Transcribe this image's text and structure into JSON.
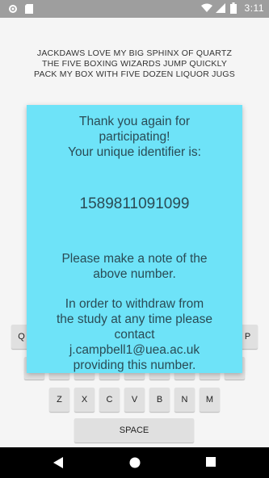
{
  "status_bar": {
    "time": "3:11",
    "left_icons": [
      "settings-icon",
      "sd-card-icon"
    ],
    "right_icons": [
      "wifi-icon",
      "signal-icon",
      "battery-icon"
    ]
  },
  "pangrams": [
    "JACKDAWS LOVE MY BIG SPHINX OF QUARTZ",
    "THE FIVE BOXING WIZARDS JUMP QUICKLY",
    "PACK MY BOX WITH FIVE DOZEN LIQUOR JUGS"
  ],
  "keyboard": {
    "visible_left_key": "Q",
    "visible_right_key": "P",
    "bottom_row": [
      "Z",
      "X",
      "C",
      "V",
      "B",
      "N",
      "M"
    ],
    "space_label": "SPACE"
  },
  "dialog": {
    "line1": "Thank you again for",
    "line2": "participating!",
    "line3": "Your unique identifier is:",
    "identifier": "1589811091099",
    "note1": "Please make a note of the",
    "note2": "above number.",
    "withdraw1": "In order to withdraw from",
    "withdraw2": "the study at any time please",
    "withdraw3": "contact",
    "email": "j.campbell1@uea.ac.uk",
    "withdraw4": "providing this number."
  },
  "nav_bar": {
    "icons": [
      "back-icon",
      "home-icon",
      "recents-icon"
    ]
  },
  "colors": {
    "dialog_bg": "#6ee3f8",
    "dialog_text": "#2a4b55",
    "status_bar_bg": "#9e9e9e",
    "nav_bar_bg": "#000000"
  }
}
